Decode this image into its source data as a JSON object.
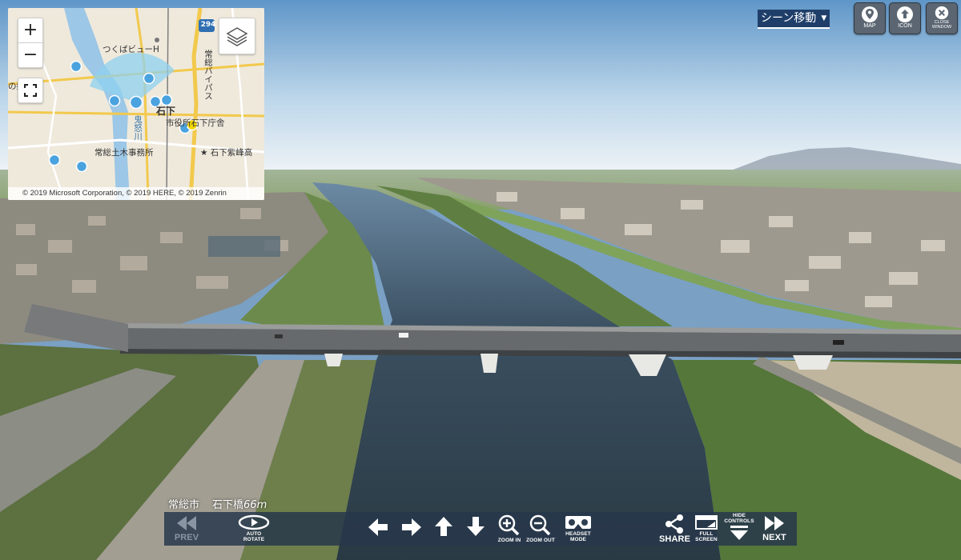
{
  "map": {
    "zoom_in": "+",
    "zoom_out": "−",
    "attribution": "© 2019 Microsoft Corporation, © 2019 HERE, © 2019 Zenrin",
    "labels": {
      "tsukuba_view": "つくばビューH",
      "road_294": "294",
      "bypass": "常総バイパス",
      "ishige": "石下",
      "city_office": "市役所石下庁舎",
      "doboku": "常総土木事務所",
      "kinugawa": "鬼怒川",
      "ishige_high": "石下紫峰高",
      "partial": "の郷"
    }
  },
  "top_controls": {
    "scene_move": "シーン移動",
    "map_label": "MAP",
    "icon_label": "ICON",
    "close_label_1": "CLOSE",
    "close_label_2": "WINDOW"
  },
  "caption": {
    "city": "常総市",
    "place": "石下橋",
    "height": "66m"
  },
  "controls": {
    "prev": "PREV",
    "auto_rotate_1": "AUTO",
    "auto_rotate_2": "ROTATE",
    "zoom_in": "ZOOM IN",
    "zoom_out": "ZOOM OUT",
    "headset_1": "HEADSET",
    "headset_2": "MODE",
    "share": "SHARE",
    "full_screen_1": "FULL",
    "full_screen_2": "SCREEN",
    "hide_controls_1": "HIDE",
    "hide_controls_2": "CONTROLS",
    "next": "NEXT"
  },
  "colors": {
    "accent": "#1f3f6a",
    "marker": "#4aa3df",
    "marker_active": "#f2d600"
  }
}
